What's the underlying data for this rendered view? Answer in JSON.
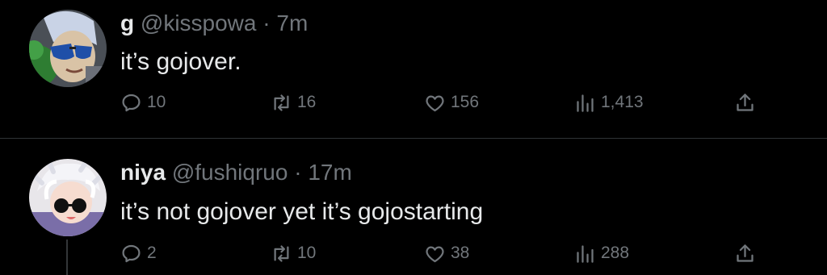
{
  "tweets": [
    {
      "name": "g",
      "handle": "@kisspowa",
      "time": "7m",
      "text": "it’s gojover.",
      "replies": "10",
      "retweets": "16",
      "likes": "156",
      "views": "1,413"
    },
    {
      "name": "niya",
      "handle": "@fushiqruo",
      "time": "17m",
      "text": "it’s not gojover yet it’s gojostarting",
      "replies": "2",
      "retweets": "10",
      "likes": "38",
      "views": "288"
    }
  ],
  "separator": " · ",
  "icons": [
    "reply-icon",
    "retweet-icon",
    "like-icon",
    "views-icon",
    "share-icon"
  ],
  "colors": {
    "background": "#000000",
    "text": "#e7e9ea",
    "muted": "#71767b",
    "divider": "#2f3336"
  }
}
